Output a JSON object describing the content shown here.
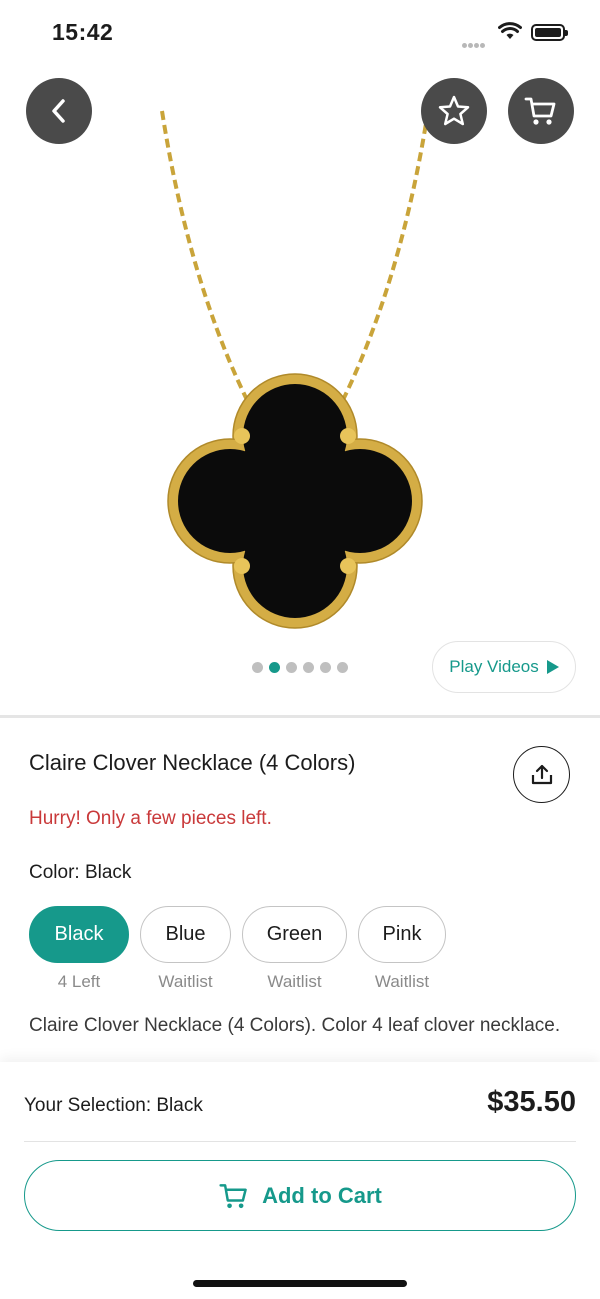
{
  "status_bar": {
    "time": "15:42"
  },
  "product": {
    "title": "Claire Clover Necklace (4 Colors)",
    "urgency": "Hurry! Only a few pieces left.",
    "color_label": "Color: Black",
    "description": "Claire Clover Necklace (4 Colors). Color 4 leaf clover necklace.",
    "image_count": 6,
    "active_image_index": 1
  },
  "media": {
    "play_videos_label": "Play Videos"
  },
  "colors": [
    {
      "label": "Black",
      "sub": "4 Left",
      "selected": true
    },
    {
      "label": "Blue",
      "sub": "Waitlist",
      "selected": false
    },
    {
      "label": "Green",
      "sub": "Waitlist",
      "selected": false
    },
    {
      "label": "Pink",
      "sub": "Waitlist",
      "selected": false
    }
  ],
  "checkout": {
    "selection": "Your Selection: Black",
    "price": "$35.50",
    "add_to_cart_label": "Add to Cart"
  },
  "theme": {
    "accent": "#16998b",
    "urgency": "#c9393a",
    "overlay_button": "#4a4a4a"
  },
  "icons": [
    "back-icon",
    "star-icon",
    "cart-icon",
    "share-icon",
    "play-icon"
  ]
}
